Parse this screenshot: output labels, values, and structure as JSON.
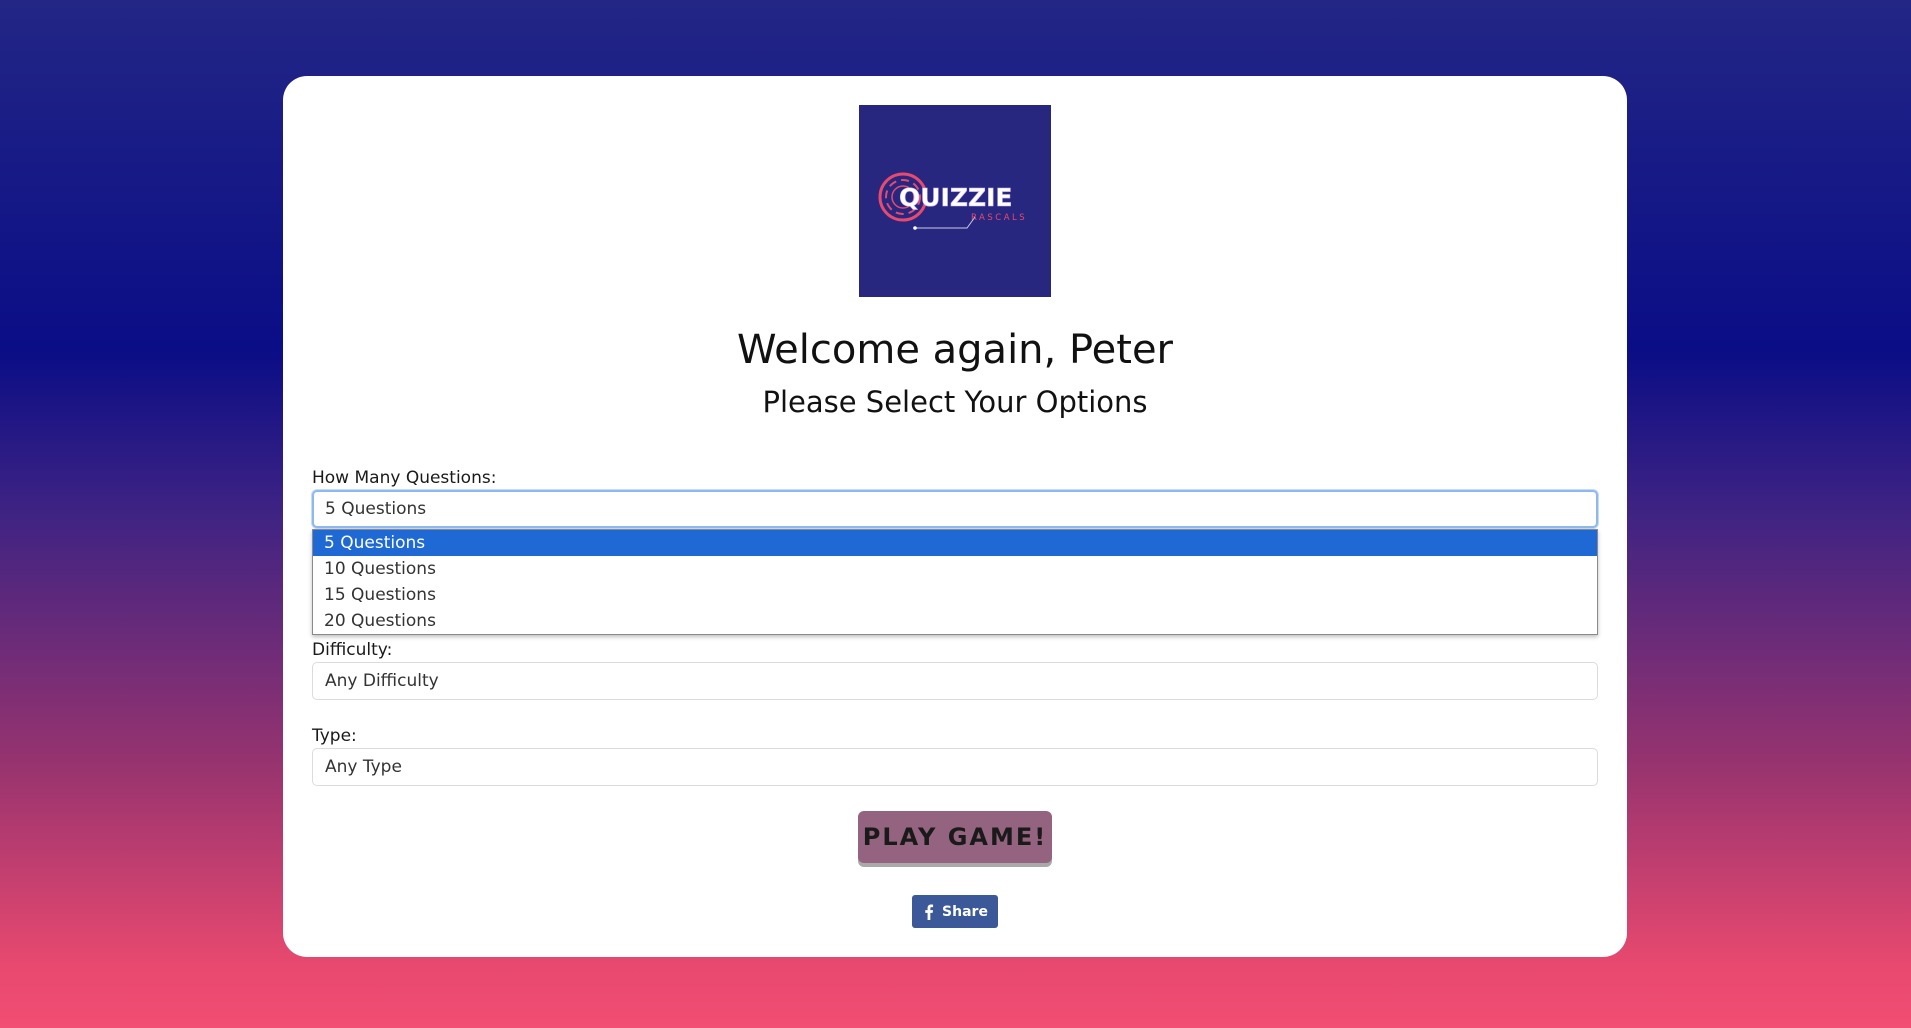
{
  "logo": {
    "text": "QUIZZIE",
    "subtext": "RASCALS",
    "background": "#27277f",
    "accent": "#e8496f"
  },
  "header": {
    "title": "Welcome again, Peter",
    "subtitle": "Please Select Your Options"
  },
  "form": {
    "questions": {
      "label": "How Many Questions:",
      "value": "5 Questions",
      "options": [
        "5 Questions",
        "10 Questions",
        "15 Questions",
        "20 Questions"
      ],
      "selected_index": 0
    },
    "difficulty": {
      "label": "Difficulty:",
      "value": "Any Difficulty"
    },
    "type": {
      "label": "Type:",
      "value": "Any Type"
    }
  },
  "actions": {
    "play_label": "PLAY GAME!",
    "share_label": "Share",
    "share_icon": "facebook-icon"
  },
  "colors": {
    "play_button": "#94637f",
    "share_button": "#3b5998",
    "selected_option": "#1f69d4",
    "focus_ring": "#8fb8ef"
  }
}
